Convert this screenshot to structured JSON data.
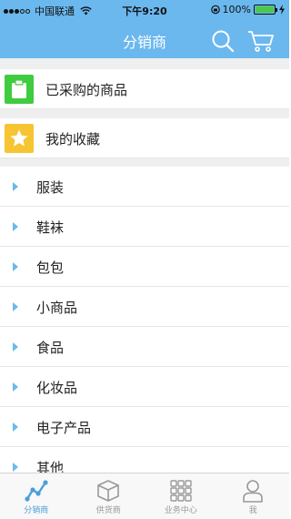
{
  "status_bar": {
    "carrier": "中国联通",
    "time": "下午9:20",
    "battery": "100%",
    "battery_level": 1.0
  },
  "nav": {
    "title": "分销商",
    "icons": [
      "search-icon",
      "cart-icon"
    ]
  },
  "features": [
    {
      "label": "已采购的商品",
      "icon": "clipboard-icon",
      "color": "#3fcc3f"
    },
    {
      "label": "我的收藏",
      "icon": "star-icon",
      "color": "#f7c531"
    }
  ],
  "categories": [
    "服装",
    "鞋袜",
    "包包",
    "小商品",
    "食品",
    "化妆品",
    "电子产品",
    "其他"
  ],
  "tabbar": {
    "tabs": [
      {
        "label": "分销商",
        "icon": "chart-line-icon",
        "active": true
      },
      {
        "label": "供货商",
        "icon": "box-icon",
        "active": false
      },
      {
        "label": "业务中心",
        "icon": "grid-icon",
        "active": false
      },
      {
        "label": "我",
        "icon": "person-icon",
        "active": false
      }
    ]
  },
  "colors": {
    "accent": "#6ab8ee",
    "tab_active": "#4a9fd8",
    "tab_inactive": "#999999"
  }
}
